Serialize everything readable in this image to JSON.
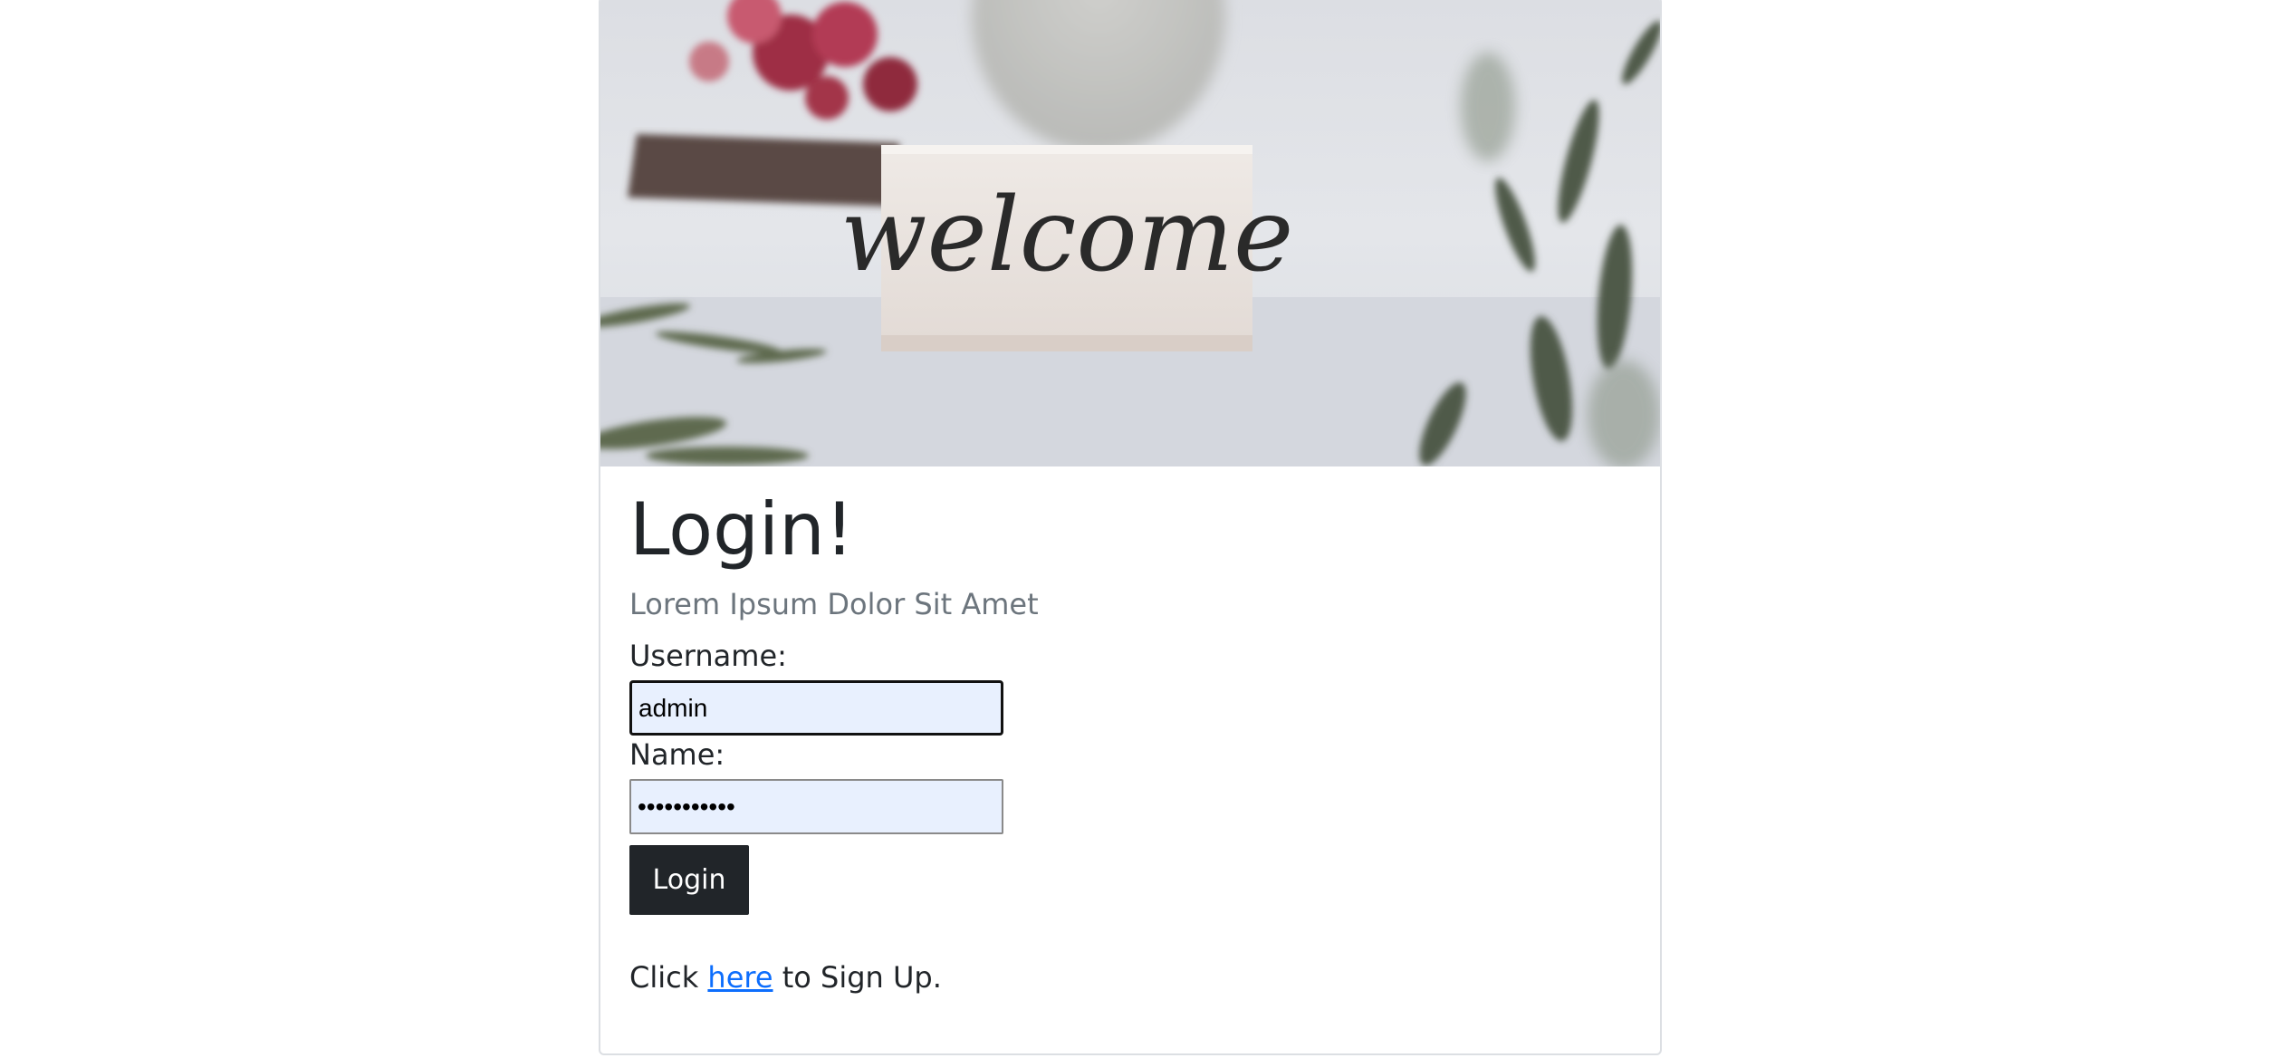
{
  "hero": {
    "sign_text": "welcome"
  },
  "login": {
    "title": "Login!",
    "subtitle": "Lorem Ipsum Dolor Sit Amet",
    "username_label": "Username:",
    "username_value": "admin",
    "name_label": "Name:",
    "name_value": "secretvalue",
    "button_label": "Login"
  },
  "signup": {
    "prefix": "Click",
    "link_text": "here",
    "suffix": "to Sign Up."
  },
  "colors": {
    "button_bg": "#212529",
    "link": "#0d6efd",
    "muted": "#6c757d",
    "autofill_bg": "#e8f0fe"
  }
}
